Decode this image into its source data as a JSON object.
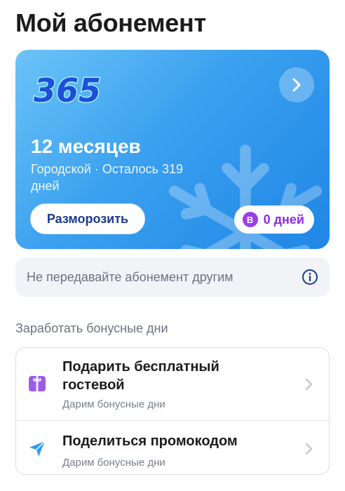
{
  "page": {
    "title": "Мой абонемент"
  },
  "subscription": {
    "logo_text": "365",
    "plan_title": "12 месяцев",
    "plan_details": "Городской · Осталось 319 дней",
    "unfreeze_label": "Разморозить",
    "bonus_badge": "B",
    "bonus_days": "0 дней",
    "gradient": [
      "#6cc3f7",
      "#1f86e6"
    ],
    "bonus_color": "#9b3de8"
  },
  "notice": {
    "text": "Не передавайте абонемент другим",
    "icon": "info-icon"
  },
  "bonus_section": {
    "title": "Заработать бонусные дни",
    "items": [
      {
        "title": "Подарить бесплатный гостевой",
        "subtitle": "Дарим бонусные дни",
        "icon": "gift-icon"
      },
      {
        "title": "Поделиться промокодом",
        "subtitle": "Дарим бонусные дни",
        "icon": "send-icon"
      }
    ]
  }
}
